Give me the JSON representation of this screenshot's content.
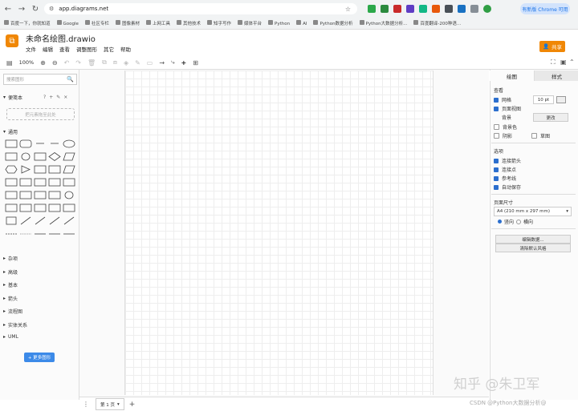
{
  "browser": {
    "url": "app.diagrams.net",
    "update_label": "有新版 Chrome 可用",
    "bookmarks": [
      "百度一下，你就知道",
      "Google",
      "社区专栏",
      "图像素材",
      "上网工具",
      "其他技术",
      "知乎写作",
      "媒体平台",
      "Python",
      "AI",
      "Python数据分析",
      "Python大数据分析...",
      "百度翻译-200种语..."
    ]
  },
  "app": {
    "doc_title": "未命名绘图.drawio",
    "menus": [
      "文件",
      "编辑",
      "查看",
      "调整图形",
      "其它",
      "帮助"
    ],
    "share_label": "共享",
    "zoom": "100%"
  },
  "left_panel": {
    "search_placeholder": "搜索图形",
    "scratchpad_title": "便笺本",
    "scratchpad_drop": "把元素拖至此处",
    "general_title": "通用",
    "sections": [
      "杂项",
      "高级",
      "基本",
      "箭头",
      "流程图",
      "实体关系",
      "UML"
    ],
    "more_shapes": "+ 更多图形"
  },
  "right_panel": {
    "tab_diagram": "绘图",
    "tab_style": "样式",
    "view_title": "查看",
    "grid_label": "网格",
    "grid_size": "10 pt",
    "page_view_label": "页面视图",
    "background_label": "背景",
    "change_label": "更改",
    "background_color_label": "背景色",
    "shadow_label": "阴影",
    "sketch_label": "草图",
    "options_title": "选项",
    "connection_arrows_label": "连接箭头",
    "connection_points_label": "连接点",
    "guides_label": "参考线",
    "autosave_label": "自动保存",
    "paper_size_title": "页面尺寸",
    "paper_size_value": "A4 (210 mm x 297 mm)",
    "portrait_label": "竖向",
    "landscape_label": "横向",
    "edit_data_label": "编辑数据...",
    "clear_default_style_label": "清除默认风格"
  },
  "bottom": {
    "page_tab": "第 1 页"
  },
  "watermark": {
    "line1": "知乎 @朱卫军",
    "line2": "CSDN @Python大数据分析@"
  }
}
